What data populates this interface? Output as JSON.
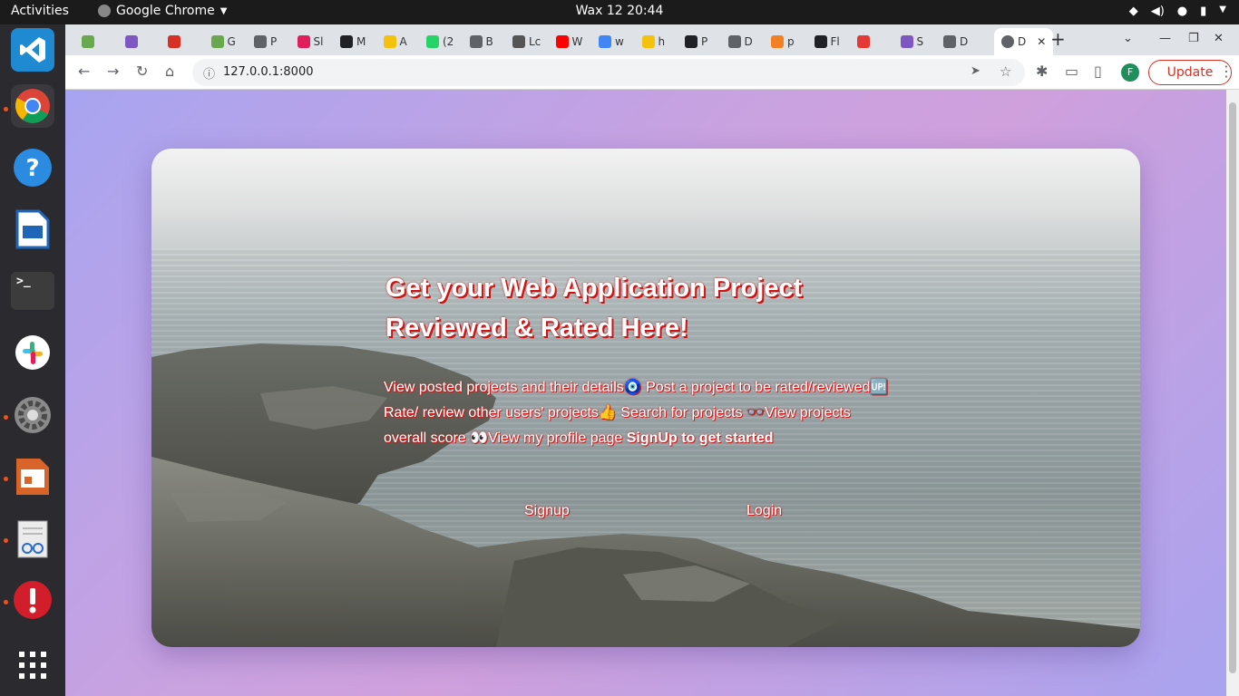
{
  "topbar": {
    "activities": "Activities",
    "app_name": "Google Chrome",
    "clock": "Wax 12  20:44"
  },
  "dock": {
    "items": [
      {
        "name": "vscode-icon",
        "color": "#1f8ad2"
      },
      {
        "name": "chrome-icon",
        "color": "#4285f4"
      },
      {
        "name": "help-icon",
        "color": "#2a8be0"
      },
      {
        "name": "writer-icon",
        "color": "#1f66b8"
      },
      {
        "name": "terminal-icon",
        "color": "#3c3c3c"
      },
      {
        "name": "slack-icon",
        "color": "#ffffff"
      },
      {
        "name": "settings-icon",
        "color": "#8a8a8a"
      },
      {
        "name": "impress-icon",
        "color": "#d9642a"
      },
      {
        "name": "document-viewer-icon",
        "color": "#ececec"
      },
      {
        "name": "update-notifier-icon",
        "color": "#d21d2a"
      },
      {
        "name": "app-grid-icon",
        "color": "#ffffff"
      }
    ]
  },
  "browser": {
    "tabs": [
      {
        "label": "",
        "color": "#6aa84f"
      },
      {
        "label": "",
        "color": "#7e57c2"
      },
      {
        "label": "",
        "color": "#d93025"
      },
      {
        "label": "G",
        "color": "#6aa84f"
      },
      {
        "label": "P",
        "color": "#5f6368"
      },
      {
        "label": "Sl",
        "color": "#e01e5a"
      },
      {
        "label": "M",
        "color": "#202124"
      },
      {
        "label": "A",
        "color": "#f4c20d"
      },
      {
        "label": "(2",
        "color": "#25d366"
      },
      {
        "label": "B",
        "color": "#5f6368"
      },
      {
        "label": "Lc",
        "color": "#555555"
      },
      {
        "label": "W",
        "color": "#ff0000"
      },
      {
        "label": "w",
        "color": "#4285f4"
      },
      {
        "label": "h",
        "color": "#f4c20d"
      },
      {
        "label": "P",
        "color": "#202124"
      },
      {
        "label": "D",
        "color": "#5f6368"
      },
      {
        "label": "p",
        "color": "#f48024"
      },
      {
        "label": "Fl",
        "color": "#202124"
      },
      {
        "label": "",
        "color": "#e53935"
      },
      {
        "label": "S",
        "color": "#7e57c2"
      },
      {
        "label": "D",
        "color": "#5f6368"
      }
    ],
    "url": "127.0.0.1:8000",
    "update_label": "Update",
    "avatar_letter": "F",
    "new_tab": "+"
  },
  "hero": {
    "title_line1": "Get your Web Application Project",
    "title_line2": "Reviewed & Rated Here!",
    "line1": "View posted projects and their details🧿 Post a project to be rated/reviewed🆙",
    "line2": "Rate/ review other users' projects👍 Search for projects 👓View projects",
    "line3_a": "overall score 👀View my profile page ",
    "line3_b": "SignUp to get started",
    "signup": "Signup",
    "login": "Login"
  }
}
